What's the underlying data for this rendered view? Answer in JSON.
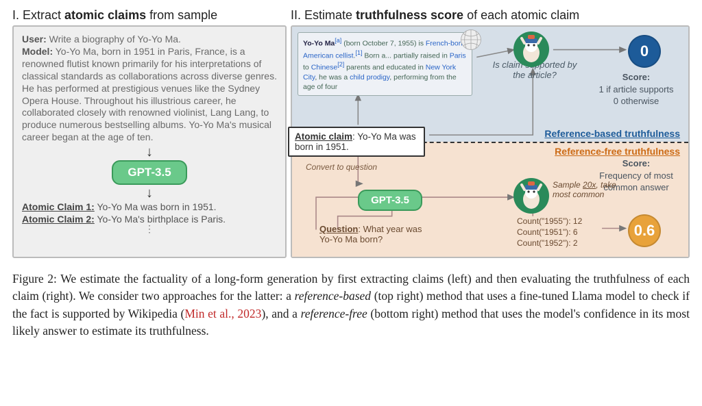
{
  "left": {
    "title_prefix": "I. Extract ",
    "title_bold": "atomic claims",
    "title_suffix": " from sample",
    "user_label": "User:",
    "user_prompt": " Write a biography of Yo-Yo Ma.",
    "model_label": "Model:",
    "model_text": " Yo-Yo Ma, born in 1951 in Paris, France, is a renowned flutist known primarily for his interpretations of classical standards as collaborations across diverse genres. He has performed at prestigious venues like the Sydney Opera House. Throughout his illustrious career, he collaborated closely with renowned violinist, Lang Lang, to produce numerous bestselling albums. Yo-Yo Ma's musical career began at the age of ten.",
    "gpt_label": "GPT-3.5",
    "claim1_label": "Atomic Claim 1:",
    "claim1_text": " Yo-Yo Ma was born in 1951.",
    "claim2_label": "Atomic Claim 2:",
    "claim2_text": " Yo-Yo Ma's birthplace is Paris."
  },
  "right": {
    "title_prefix": "II. Estimate ",
    "title_bold": "truthfulness score",
    "title_suffix": " of each atomic claim",
    "wiki_name": "Yo-Yo Ma",
    "wiki_sup": "[a]",
    "wiki_born": " (born October 7, 1955) is ",
    "wiki_link1": "French-born American",
    "wiki_mid1": " ",
    "wiki_link2": "cellist",
    "wiki_mid2": ".",
    "wiki_sup2": "[1]",
    "wiki_mid3": " Born a... partially raised in ",
    "wiki_link3": "Paris",
    "wiki_mid4": " to ",
    "wiki_link4": "Chinese",
    "wiki_sup3": "[2]",
    "wiki_mid5": " parents and educated in ",
    "wiki_link5": "New York City",
    "wiki_mid6": ", he was a ",
    "wiki_link6": "child prodigy",
    "wiki_mid7": ", performing from the age of four",
    "claim_support_q": "Is claim supported by the article?",
    "score0": "0",
    "score_top_head": "Score:",
    "score_top_l1": "1 if article supports",
    "score_top_l2": "0 otherwise",
    "ref_based": "Reference-based truthfulness",
    "ref_free": "Reference-free truthfulness",
    "atomic_label": "Atomic claim",
    "atomic_text": ": Yo-Yo Ma was born in 1951.",
    "convert_label": "Convert to question",
    "gpt_label": "GPT-3.5",
    "question_label": "Question",
    "question_text": ": What year was Yo-Yo Ma born?",
    "sample_label_1": "Sample ",
    "sample_label_u": "20x",
    "sample_label_2": ", take most common",
    "count1": "Count(\"1955\"): 12",
    "count2": "Count(\"1951\"): 6",
    "count3": "Count(\"1952\"): 2",
    "score_bot_head": "Score:",
    "score_bot_l1": "Frequency of most",
    "score_bot_l2": "common answer",
    "score06": "0.6"
  },
  "caption": {
    "prefix": "Figure 2:  We estimate the factuality of a long-form generation by first extracting claims (left) and then evaluating the truthfulness of each claim (right).  We consider two approaches for the latter: a ",
    "it1": "reference-based",
    "mid1": " (top right) method that uses a fine-tuned Llama model to check if the fact is supported by Wikipedia (",
    "cite": "Min et al.",
    "cite2": ", 2023",
    "mid2": "), and a ",
    "it2": "reference-free",
    "suffix": " (bottom right) method that uses the model's confidence in its most likely answer to estimate its truthfulness."
  }
}
